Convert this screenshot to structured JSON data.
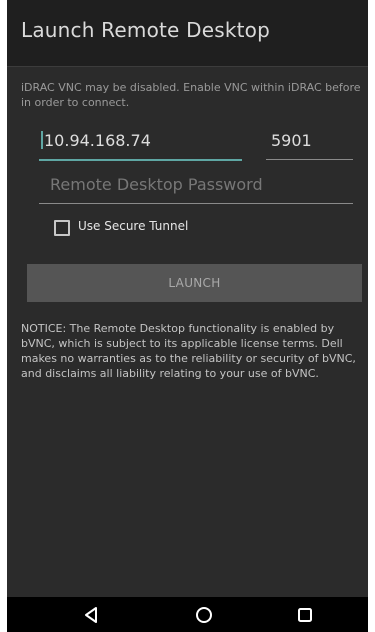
{
  "header": {
    "title": "Launch Remote Desktop"
  },
  "info_text": "iDRAC VNC may be disabled. Enable VNC within iDRAC before in order to connect.",
  "form": {
    "ip_value": "10.94.168.74",
    "port_value": "5901",
    "password_placeholder": "Remote Desktop Password",
    "secure_tunnel_label": "Use Secure Tunnel",
    "secure_tunnel_checked": false,
    "launch_label": "LAUNCH"
  },
  "notice_text": "NOTICE: The Remote Desktop functionality is enabled by bVNC, which is subject to its applicable license terms. Dell makes no warranties as to the reliability or security of bVNC, and disclaims all liability relating to your use of bVNC.",
  "navbar": {
    "icons": [
      "back-icon",
      "home-icon",
      "recents-icon"
    ]
  },
  "colors": {
    "background": "#2b2b2b",
    "titlebar": "#1f1f1f",
    "accent": "#5fa7a4",
    "button": "#555555",
    "navbar": "#000000"
  }
}
